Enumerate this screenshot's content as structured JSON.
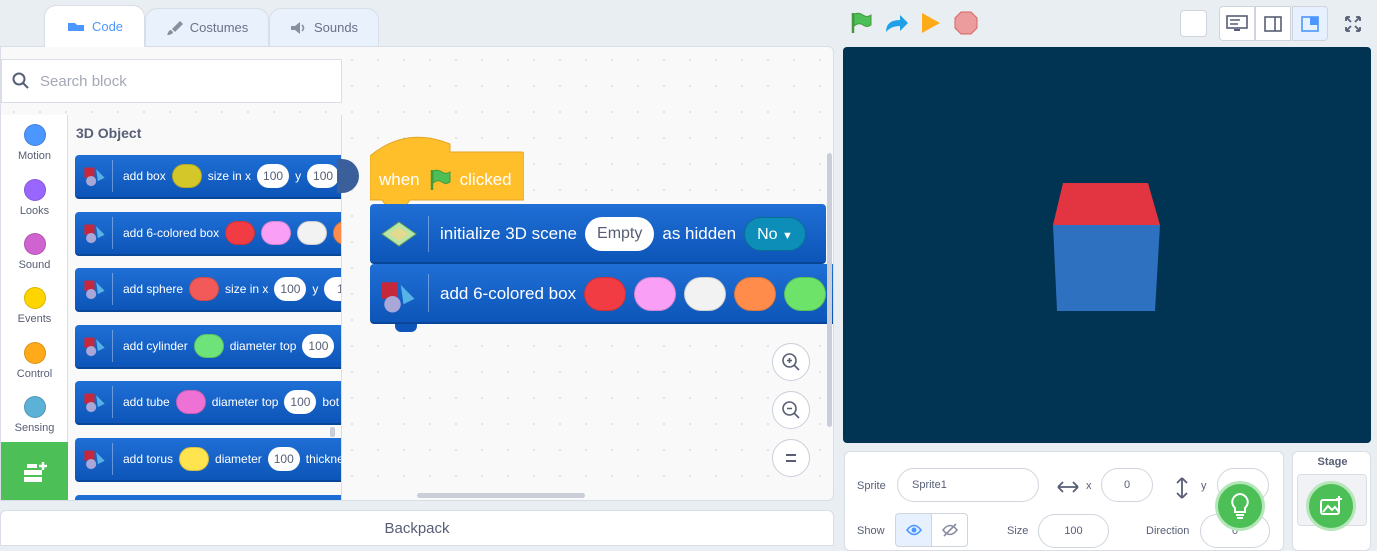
{
  "tabs": [
    {
      "label": "Code"
    },
    {
      "label": "Costumes"
    },
    {
      "label": "Sounds"
    }
  ],
  "search": {
    "placeholder": "Search block"
  },
  "categories": [
    {
      "label": "Motion",
      "color": "#4c97ff"
    },
    {
      "label": "Looks",
      "color": "#9966ff"
    },
    {
      "label": "Sound",
      "color": "#cf63cf"
    },
    {
      "label": "Events",
      "color": "#ffd500"
    },
    {
      "label": "Control",
      "color": "#ffab19"
    },
    {
      "label": "Sensing",
      "color": "#5cb1d6"
    }
  ],
  "palette": {
    "title": "3D Object",
    "blocks": [
      {
        "text": "add box",
        "color": "#d3c72a",
        "param1": "size in x",
        "val1": "100",
        "param2": "y",
        "val2": "100"
      },
      {
        "text": "add 6-colored box",
        "colors": [
          "#f23c44",
          "#f99ff5",
          "#f2f2f2",
          "#ff8c4a"
        ]
      },
      {
        "text": "add sphere",
        "color": "#f25a5a",
        "param1": "size in x",
        "val1": "100",
        "param2": "y",
        "val2": "1"
      },
      {
        "text": "add cylinder",
        "color": "#6de37a",
        "param1": "diameter top",
        "val1": "100"
      },
      {
        "text": "add tube",
        "color": "#ee71d5",
        "param1": "diameter top",
        "val1": "100",
        "param2": "bot"
      },
      {
        "text": "add torus",
        "color": "#ffe34f",
        "param1": "diameter",
        "val1": "100",
        "param2": "thickne"
      }
    ]
  },
  "script": {
    "hat": {
      "when": "when",
      "clicked": "clicked"
    },
    "init": {
      "text": "initialize 3D scene",
      "scene": "Empty",
      "hidden_label": "as hidden",
      "hidden_value": "No"
    },
    "add6": {
      "text": "add 6-colored box",
      "colors": [
        "#f23c44",
        "#f99ff5",
        "#f2f2f2",
        "#ff8c4a",
        "#6de36a"
      ]
    }
  },
  "backpack": {
    "label": "Backpack"
  },
  "sprite": {
    "label": "Sprite",
    "name": "Sprite1",
    "x_label": "x",
    "x": "0",
    "y_label": "y",
    "y": "",
    "show_label": "Show",
    "size_label": "Size",
    "size": "100",
    "direction_label": "Direction",
    "direction": "0"
  },
  "stage_panel": {
    "label": "Stage"
  },
  "stage_cube": {
    "top": "#e33441",
    "front": "#2e71c0"
  }
}
